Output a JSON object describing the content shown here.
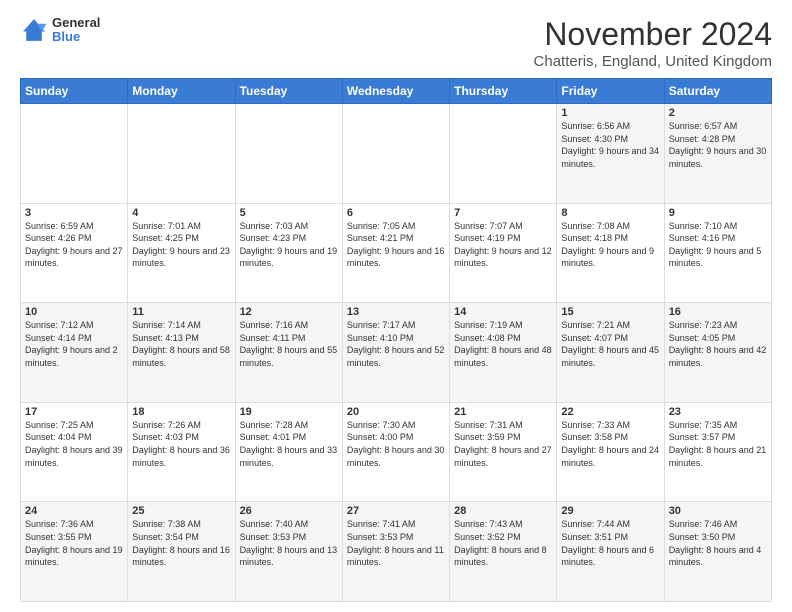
{
  "header": {
    "logo": {
      "general": "General",
      "blue": "Blue"
    },
    "title": "November 2024",
    "subtitle": "Chatteris, England, United Kingdom"
  },
  "calendar": {
    "days_of_week": [
      "Sunday",
      "Monday",
      "Tuesday",
      "Wednesday",
      "Thursday",
      "Friday",
      "Saturday"
    ],
    "weeks": [
      [
        {
          "day": "",
          "info": ""
        },
        {
          "day": "",
          "info": ""
        },
        {
          "day": "",
          "info": ""
        },
        {
          "day": "",
          "info": ""
        },
        {
          "day": "",
          "info": ""
        },
        {
          "day": "1",
          "info": "Sunrise: 6:56 AM\nSunset: 4:30 PM\nDaylight: 9 hours and 34 minutes."
        },
        {
          "day": "2",
          "info": "Sunrise: 6:57 AM\nSunset: 4:28 PM\nDaylight: 9 hours and 30 minutes."
        }
      ],
      [
        {
          "day": "3",
          "info": "Sunrise: 6:59 AM\nSunset: 4:26 PM\nDaylight: 9 hours and 27 minutes."
        },
        {
          "day": "4",
          "info": "Sunrise: 7:01 AM\nSunset: 4:25 PM\nDaylight: 9 hours and 23 minutes."
        },
        {
          "day": "5",
          "info": "Sunrise: 7:03 AM\nSunset: 4:23 PM\nDaylight: 9 hours and 19 minutes."
        },
        {
          "day": "6",
          "info": "Sunrise: 7:05 AM\nSunset: 4:21 PM\nDaylight: 9 hours and 16 minutes."
        },
        {
          "day": "7",
          "info": "Sunrise: 7:07 AM\nSunset: 4:19 PM\nDaylight: 9 hours and 12 minutes."
        },
        {
          "day": "8",
          "info": "Sunrise: 7:08 AM\nSunset: 4:18 PM\nDaylight: 9 hours and 9 minutes."
        },
        {
          "day": "9",
          "info": "Sunrise: 7:10 AM\nSunset: 4:16 PM\nDaylight: 9 hours and 5 minutes."
        }
      ],
      [
        {
          "day": "10",
          "info": "Sunrise: 7:12 AM\nSunset: 4:14 PM\nDaylight: 9 hours and 2 minutes."
        },
        {
          "day": "11",
          "info": "Sunrise: 7:14 AM\nSunset: 4:13 PM\nDaylight: 8 hours and 58 minutes."
        },
        {
          "day": "12",
          "info": "Sunrise: 7:16 AM\nSunset: 4:11 PM\nDaylight: 8 hours and 55 minutes."
        },
        {
          "day": "13",
          "info": "Sunrise: 7:17 AM\nSunset: 4:10 PM\nDaylight: 8 hours and 52 minutes."
        },
        {
          "day": "14",
          "info": "Sunrise: 7:19 AM\nSunset: 4:08 PM\nDaylight: 8 hours and 48 minutes."
        },
        {
          "day": "15",
          "info": "Sunrise: 7:21 AM\nSunset: 4:07 PM\nDaylight: 8 hours and 45 minutes."
        },
        {
          "day": "16",
          "info": "Sunrise: 7:23 AM\nSunset: 4:05 PM\nDaylight: 8 hours and 42 minutes."
        }
      ],
      [
        {
          "day": "17",
          "info": "Sunrise: 7:25 AM\nSunset: 4:04 PM\nDaylight: 8 hours and 39 minutes."
        },
        {
          "day": "18",
          "info": "Sunrise: 7:26 AM\nSunset: 4:03 PM\nDaylight: 8 hours and 36 minutes."
        },
        {
          "day": "19",
          "info": "Sunrise: 7:28 AM\nSunset: 4:01 PM\nDaylight: 8 hours and 33 minutes."
        },
        {
          "day": "20",
          "info": "Sunrise: 7:30 AM\nSunset: 4:00 PM\nDaylight: 8 hours and 30 minutes."
        },
        {
          "day": "21",
          "info": "Sunrise: 7:31 AM\nSunset: 3:59 PM\nDaylight: 8 hours and 27 minutes."
        },
        {
          "day": "22",
          "info": "Sunrise: 7:33 AM\nSunset: 3:58 PM\nDaylight: 8 hours and 24 minutes."
        },
        {
          "day": "23",
          "info": "Sunrise: 7:35 AM\nSunset: 3:57 PM\nDaylight: 8 hours and 21 minutes."
        }
      ],
      [
        {
          "day": "24",
          "info": "Sunrise: 7:36 AM\nSunset: 3:55 PM\nDaylight: 8 hours and 19 minutes."
        },
        {
          "day": "25",
          "info": "Sunrise: 7:38 AM\nSunset: 3:54 PM\nDaylight: 8 hours and 16 minutes."
        },
        {
          "day": "26",
          "info": "Sunrise: 7:40 AM\nSunset: 3:53 PM\nDaylight: 8 hours and 13 minutes."
        },
        {
          "day": "27",
          "info": "Sunrise: 7:41 AM\nSunset: 3:53 PM\nDaylight: 8 hours and 11 minutes."
        },
        {
          "day": "28",
          "info": "Sunrise: 7:43 AM\nSunset: 3:52 PM\nDaylight: 8 hours and 8 minutes."
        },
        {
          "day": "29",
          "info": "Sunrise: 7:44 AM\nSunset: 3:51 PM\nDaylight: 8 hours and 6 minutes."
        },
        {
          "day": "30",
          "info": "Sunrise: 7:46 AM\nSunset: 3:50 PM\nDaylight: 8 hours and 4 minutes."
        }
      ]
    ]
  }
}
